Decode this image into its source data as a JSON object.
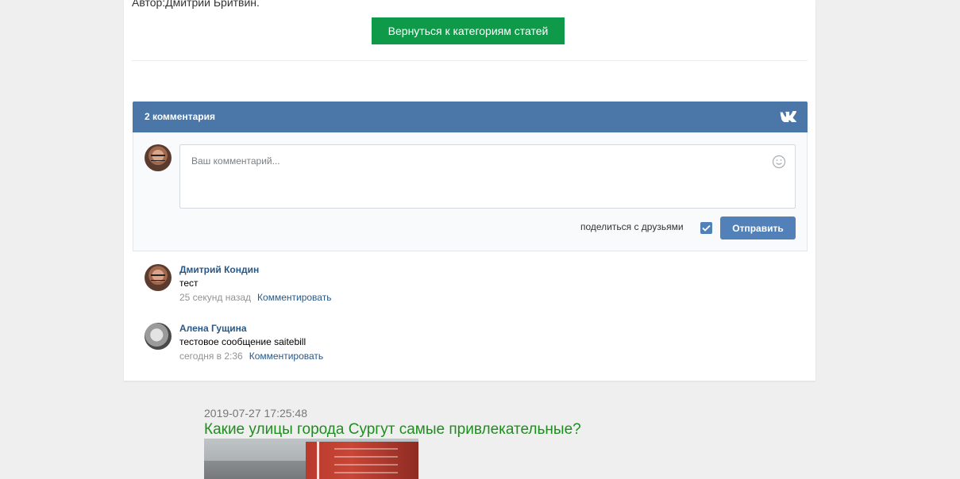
{
  "article": {
    "author": "Автор:Дмитрий Бритвин.",
    "back_button": "Вернуться к категориям статей"
  },
  "widget": {
    "comments_count": "2 комментария",
    "brand_icon": "vk-logo-icon",
    "placeholder": "Ваш комментарий...",
    "share_label": "поделиться с друзьями",
    "share_checked": true,
    "submit_label": "Отправить",
    "accent_color": "#4a76a8",
    "button_color": "#5181b8"
  },
  "comments": [
    {
      "author": "Дмитрий Кондин",
      "text": "тест",
      "time": "25 секунд назад",
      "reply_label": "Комментировать"
    },
    {
      "author": "Алена Гущина",
      "text": "тестовое сообщение saitebill",
      "time": "сегодня в 2:36",
      "reply_label": "Комментировать"
    }
  ],
  "next_post": {
    "date": "2019-07-27 17:25:48",
    "title": "Какие улицы города Сургут самые привлекательные?"
  }
}
